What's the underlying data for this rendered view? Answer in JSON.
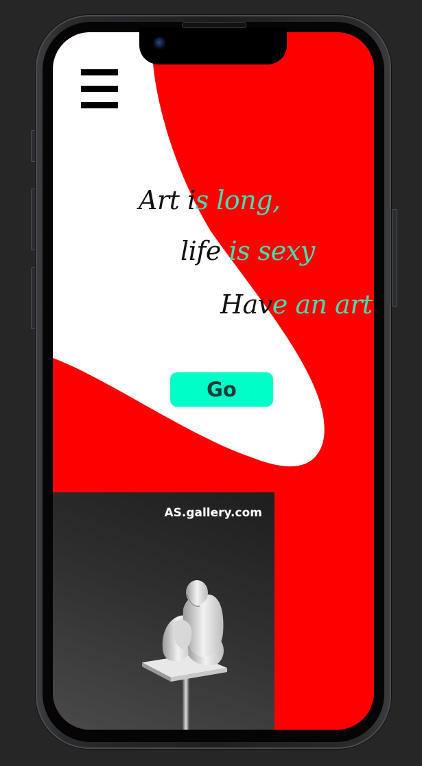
{
  "hero": {
    "quote_line1_a": "Art i",
    "quote_line1_b": "s long,",
    "quote_line2_a": "life ",
    "quote_line2_b": "is sexy",
    "quote_line3_a": "Hav",
    "quote_line3_b": "e an art !"
  },
  "cta": {
    "go_label": "Go"
  },
  "gallery": {
    "url": "AS.gallery.com"
  },
  "colors": {
    "accent_red": "#ff0000",
    "accent_mint": "#00ffc8",
    "quote_mint": "#3fe0b0"
  },
  "icons": {
    "menu": "hamburger-menu-icon"
  }
}
